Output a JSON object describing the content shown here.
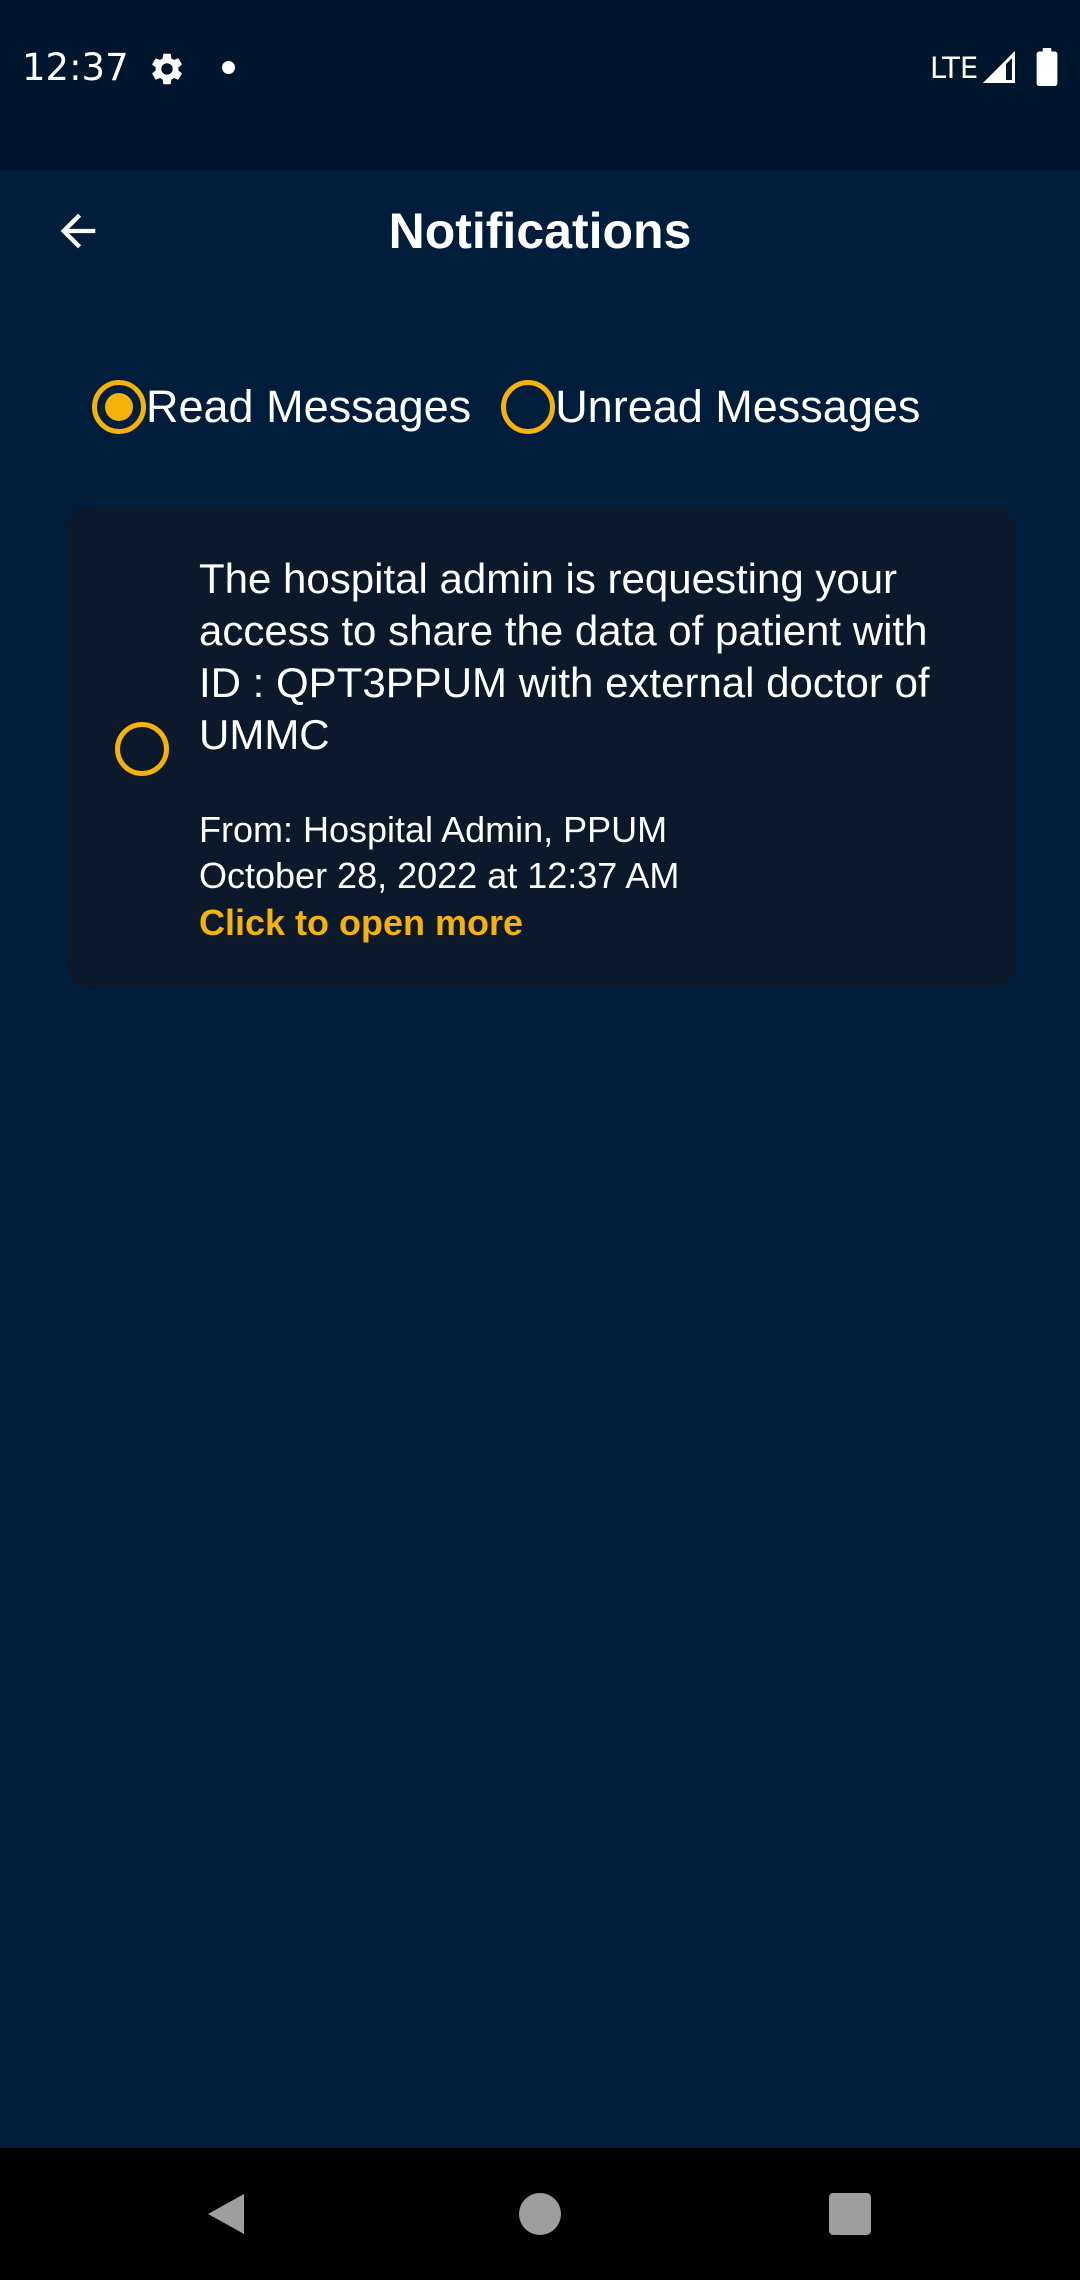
{
  "status_bar": {
    "time": "12:37",
    "network": "LTE",
    "icons": [
      "gear-icon",
      "notification-dot-icon",
      "signal-icon",
      "battery-icon"
    ]
  },
  "app_bar": {
    "title": "Notifications",
    "back_icon": "arrow-left-icon"
  },
  "filter": {
    "options": [
      {
        "label": "Read Messages",
        "selected": true
      },
      {
        "label": "Unread Messages",
        "selected": false
      }
    ]
  },
  "notifications": [
    {
      "message": "The hospital admin is requesting your access to share the data of patient with ID : QPT3PPUM with external doctor of UMMC",
      "from": "From: Hospital Admin, PPUM",
      "date": "October 28, 2022 at 12:37 AM",
      "link": "Click to open more",
      "selected": false
    }
  ],
  "nav_bar": {
    "icons": [
      "nav-back-icon",
      "nav-home-icon",
      "nav-recents-icon"
    ]
  },
  "colors": {
    "background": "#001e3b",
    "status_bar": "#00152e",
    "card": "#0c192b",
    "accent": "#f5b20a",
    "text": "#ffffff",
    "nav_bar": "#000000"
  }
}
